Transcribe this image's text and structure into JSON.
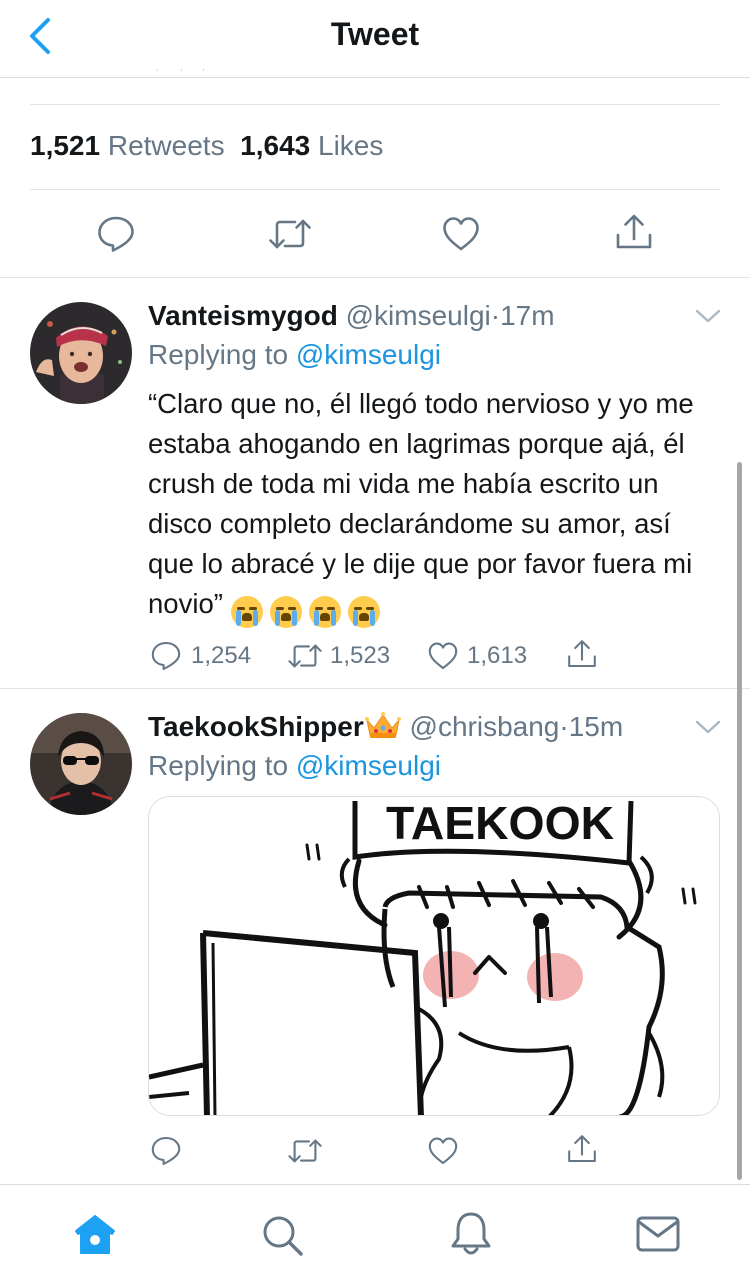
{
  "header": {
    "title": "Tweet",
    "back_icon": "chevron-left-icon"
  },
  "stats": {
    "retweets_count": "1,521",
    "retweets_label": "Retweets",
    "likes_count": "1,643",
    "likes_label": "Likes"
  },
  "main_actions": [
    "reply-icon",
    "retweet-icon",
    "like-icon",
    "share-icon"
  ],
  "replies": [
    {
      "name": "Vanteismygod",
      "handle": "@kimseulgi",
      "dot": "·",
      "time": "17m",
      "replying_prefix": "Replying to",
      "replying_to": "@kimseulgi",
      "text": "“Claro que no, él llegó todo nervioso y yo me estaba ahogando en lagrimas porque ajá, él crush de toda mi vida me había escrito un disco completo declarándome su amor, así que lo abracé y le dije que por favor fuera mi novio”",
      "emoji": "loudly-crying-face",
      "emoji_count": 4,
      "reply_count": "1,254",
      "retweet_count": "1,523",
      "like_count": "1,613"
    },
    {
      "name": "TaekookShipper",
      "name_emoji": "crown",
      "handle": "@chrisbang",
      "dot": "·",
      "time": "15m",
      "replying_prefix": "Replying to",
      "replying_to": "@kimseulgi",
      "media_caption": "TAEKOOK"
    }
  ],
  "tabbar": {
    "items": [
      "home-icon",
      "search-icon",
      "notifications-icon",
      "messages-icon"
    ]
  },
  "colors": {
    "accent": "#1da1f2",
    "mention": "#1b95e0",
    "secondary_text": "#657786",
    "icon": "#657786",
    "divider": "#e1e5e8"
  }
}
